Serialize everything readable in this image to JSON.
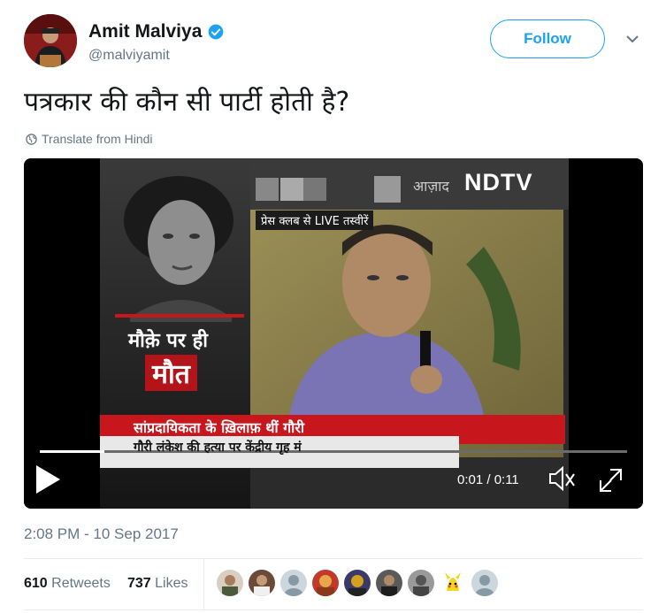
{
  "author": {
    "name": "Amit Malviya",
    "handle": "@malviyamit"
  },
  "follow_label": "Follow",
  "tweet": {
    "text": "पत्रकार की कौन सी पार्टी होती है?",
    "translate_label": "Translate from Hindi",
    "timestamp": "2:08 PM - 10 Sep 2017"
  },
  "video": {
    "channel_logo": "NDTV",
    "live_banner": "प्रेस क्लब से LIVE तस्वीरें",
    "left_caption_line1": "मौक़े पर ही",
    "left_caption_line2": "मौत",
    "top_thumb_text": "आज़ाद",
    "ticker_line1": "सांप्रदायिकता के ख़िलाफ़ थीं गौरी",
    "ticker_line2": "गौरी लंकेश की हत्या पर केंद्रीय गृह मं",
    "time_display": "0:01 / 0:11",
    "progress": 0.11
  },
  "stats": {
    "retweets_count": "610",
    "retweets_label": "Retweets",
    "likes_count": "737",
    "likes_label": "Likes"
  },
  "colors": {
    "accent": "#1da1f2",
    "ticker_red": "#c8161d"
  }
}
